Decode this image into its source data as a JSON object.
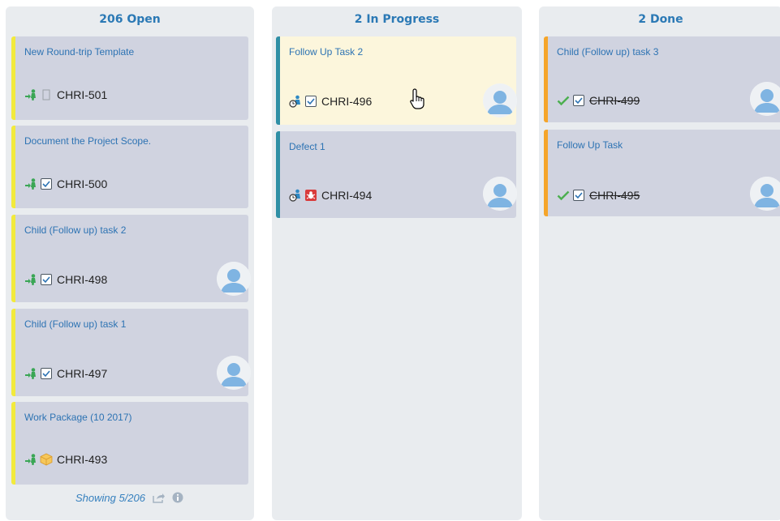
{
  "columns": [
    {
      "header": "206 Open",
      "footer": "Showing 5/206",
      "cards": [
        {
          "title": "New Round-trip Template",
          "id": "CHRI-501"
        },
        {
          "title": "Document the Project Scope.",
          "id": "CHRI-500"
        },
        {
          "title": "Child (Follow up) task 2",
          "id": "CHRI-498"
        },
        {
          "title": "Child (Follow up) task 1",
          "id": "CHRI-497"
        },
        {
          "title": "Work Package (10 2017)",
          "id": "CHRI-493"
        }
      ]
    },
    {
      "header": "2 In Progress",
      "cards": [
        {
          "title": "Follow Up Task 2",
          "id": "CHRI-496"
        },
        {
          "title": "Defect 1",
          "id": "CHRI-494"
        }
      ]
    },
    {
      "header": "2 Done",
      "cards": [
        {
          "title": "Child (Follow up) task 3",
          "id": "CHRI-499"
        },
        {
          "title": "Follow Up Task",
          "id": "CHRI-495"
        }
      ]
    }
  ],
  "colors": {
    "header_text": "#2b79b5",
    "card_title": "#2d73b3",
    "open_stripe": "#f2ea3c",
    "in_progress_stripe": "#2f8fa5",
    "done_stripe": "#f5a52a",
    "card_bg": "#d0d3e0",
    "hover_card_bg": "#fcf6dc",
    "column_bg": "#e9ecef"
  },
  "icons": {
    "open_status": "green-arrow-person-icon",
    "in_progress_status": "user-clock-icon",
    "done_status": "green-check-icon",
    "task_type": "checkbox-icon",
    "defect_type": "red-bug-icon",
    "package_type": "package-icon",
    "template_type": "blank-document-icon",
    "footer": [
      "share-icon",
      "info-icon"
    ]
  }
}
